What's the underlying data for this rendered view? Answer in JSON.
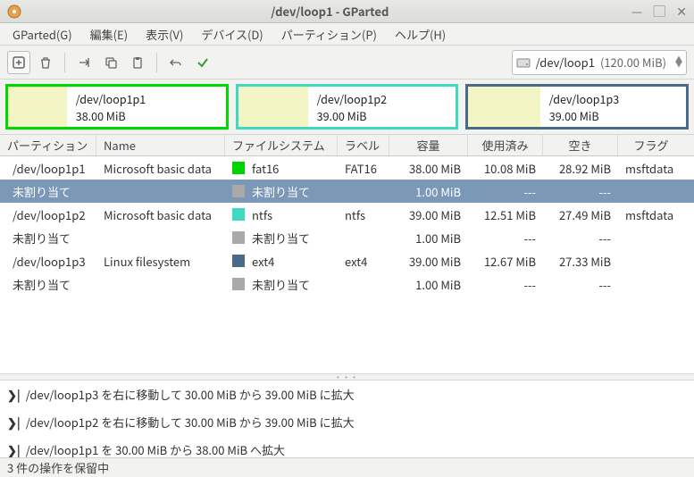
{
  "window": {
    "title": "/dev/loop1 - GParted"
  },
  "menus": {
    "gparted": "GParted(G)",
    "edit": "編集(E)",
    "view": "表示(V)",
    "device": "デバイス(D)",
    "partition": "パーティション(P)",
    "help": "ヘルプ(H)"
  },
  "device_selector": {
    "name": "/dev/loop1",
    "size": "(120.00 MiB)"
  },
  "diskmap": [
    {
      "name": "/dev/loop1p1",
      "size": "38.00 MiB",
      "border": "#00d900",
      "fill_pct": 27
    },
    {
      "name": "/dev/loop1p2",
      "size": "39.00 MiB",
      "border": "#3fd9bf",
      "fill_pct": 32
    },
    {
      "name": "/dev/loop1p3",
      "size": "39.00 MiB",
      "border": "#4a6a8a",
      "fill_pct": 33
    }
  ],
  "cols": {
    "partition": "パーティション",
    "name": "Name",
    "fs": "ファイルシステム",
    "label": "ラベル",
    "capacity": "容量",
    "used": "使用済み",
    "free": "空き",
    "flags": "フラグ"
  },
  "rows": [
    {
      "partition": "/dev/loop1p1",
      "name": "Microsoft basic data",
      "fs_color": "#00d400",
      "fs": "fat16",
      "label": "FAT16",
      "capacity": "38.00 MiB",
      "used": "10.08 MiB",
      "free": "28.92 MiB",
      "flags": "msftdata",
      "selected": false
    },
    {
      "partition": "未割り当て",
      "name": "",
      "fs_color": "#a9a9a9",
      "fs": "未割り当て",
      "label": "",
      "capacity": "1.00 MiB",
      "used": "---",
      "free": "---",
      "flags": "",
      "selected": true
    },
    {
      "partition": "/dev/loop1p2",
      "name": "Microsoft basic data",
      "fs_color": "#3fd9bf",
      "fs": "ntfs",
      "label": "ntfs",
      "capacity": "39.00 MiB",
      "used": "12.51 MiB",
      "free": "27.49 MiB",
      "flags": "msftdata",
      "selected": false
    },
    {
      "partition": "未割り当て",
      "name": "",
      "fs_color": "#a9a9a9",
      "fs": "未割り当て",
      "label": "",
      "capacity": "1.00 MiB",
      "used": "---",
      "free": "---",
      "flags": "",
      "selected": false
    },
    {
      "partition": "/dev/loop1p3",
      "name": "Linux filesystem",
      "fs_color": "#4a6a8a",
      "fs": "ext4",
      "label": "ext4",
      "capacity": "39.00 MiB",
      "used": "12.67 MiB",
      "free": "27.33 MiB",
      "flags": "",
      "selected": false
    },
    {
      "partition": "未割り当て",
      "name": "",
      "fs_color": "#a9a9a9",
      "fs": "未割り当て",
      "label": "",
      "capacity": "1.00 MiB",
      "used": "---",
      "free": "---",
      "flags": "",
      "selected": false
    }
  ],
  "ops": [
    "/dev/loop1p3 を右に移動して 30.00 MiB から 39.00 MiB に拡大",
    "/dev/loop1p2 を右に移動して 30.00 MiB から 39.00 MiB に拡大",
    "/dev/loop1p1 を 30.00 MiB から 38.00 MiB へ拡大"
  ],
  "op_prefix": "❯|",
  "status": "3 件の操作を保留中"
}
